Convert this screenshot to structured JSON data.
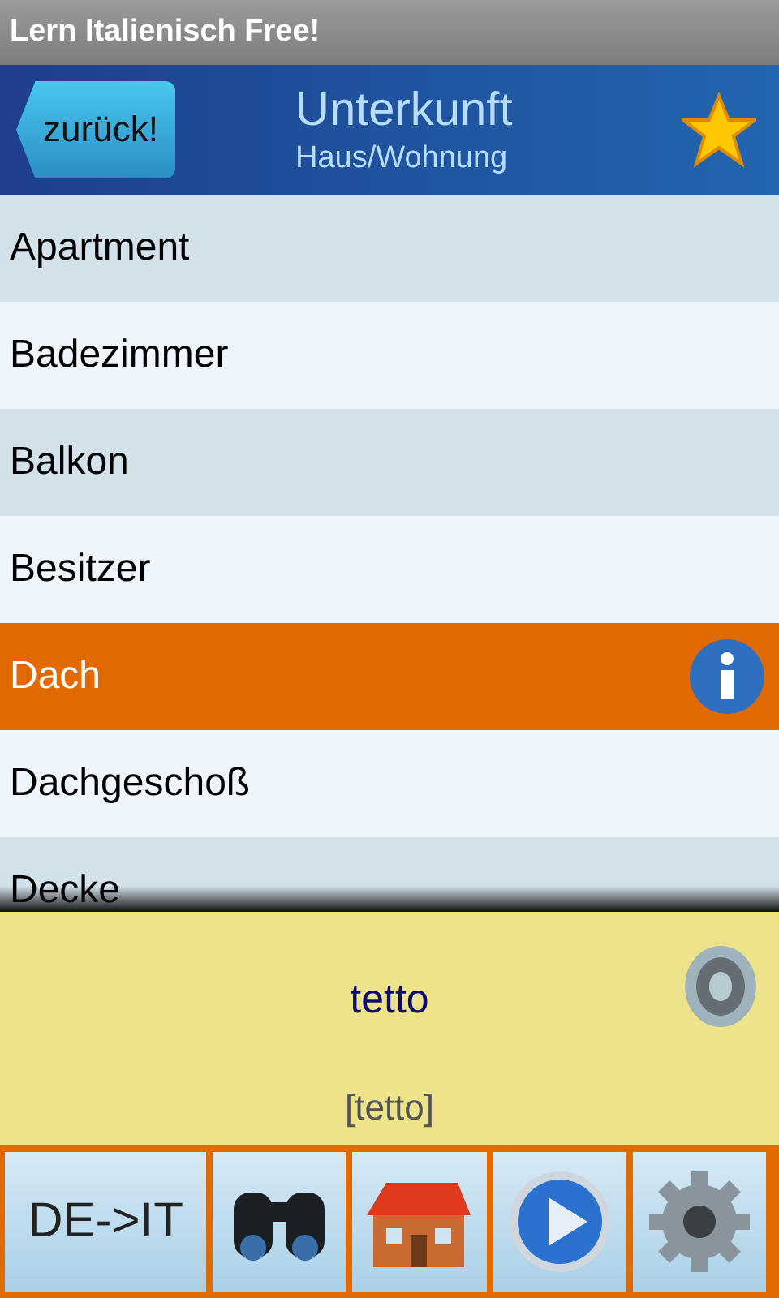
{
  "app_title": "Lern Italienisch Free!",
  "header": {
    "back_button": "zurück!",
    "title": "Unterkunft",
    "subtitle": "Haus/Wohnung",
    "favorite": true
  },
  "words": [
    {
      "label": "Apartment",
      "selected": false
    },
    {
      "label": "Badezimmer",
      "selected": false
    },
    {
      "label": "Balkon",
      "selected": false
    },
    {
      "label": "Besitzer",
      "selected": false
    },
    {
      "label": "Dach",
      "selected": true
    },
    {
      "label": "Dachgeschoß",
      "selected": false
    },
    {
      "label": "Decke",
      "selected": false
    }
  ],
  "translation": {
    "word": "tetto",
    "pronunciation": "[tetto]"
  },
  "toolbar": [
    {
      "kind": "text",
      "label": "DE->IT"
    },
    {
      "kind": "binoculars"
    },
    {
      "kind": "house"
    },
    {
      "kind": "play"
    },
    {
      "kind": "gear"
    }
  ]
}
